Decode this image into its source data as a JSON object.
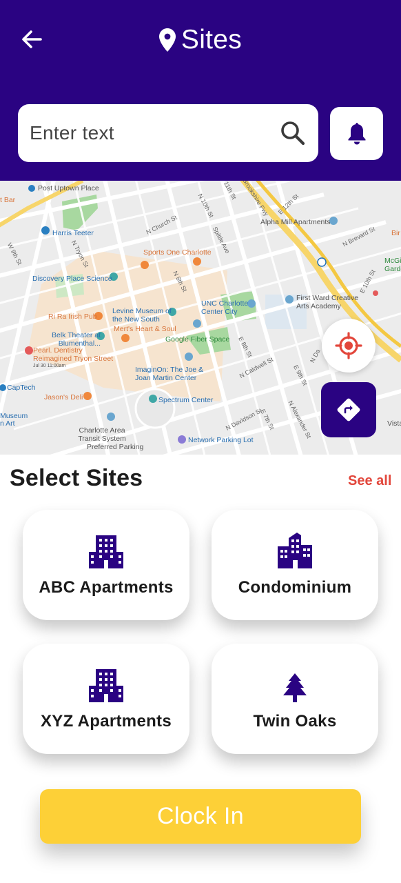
{
  "header": {
    "title": "Sites",
    "colors": {
      "primary": "#2a0382",
      "accent_yellow": "#fdd037",
      "accent_red": "#e2463b"
    },
    "back_icon": "arrow-left-icon",
    "title_icon": "map-pin-icon"
  },
  "search": {
    "placeholder": "Enter text",
    "icon": "search-icon",
    "notification_icon": "bell-icon"
  },
  "map": {
    "places": [
      "Post Uptown Place",
      "Harris Teeter",
      "Sports One Charlotte",
      "Alpha Mill Apartments",
      "Discovery Place Science",
      "UNC Charlotte Center City",
      "First Ward Creative Arts Academy",
      "Levine Museum of the New South",
      "Ri Ra Irish Pub",
      "Mert's Heart & Soul",
      "Belk Theater at Blumenthal...",
      "Google Fiber Space",
      "Pearl. Dentistry Reimagined Tryon Street",
      "Jul 30 11:00am",
      "ImaginOn: The Joe & Joan Martin Center",
      "CapTech",
      "Jason's Deli",
      "Spectrum Center",
      "Museum",
      "n Art",
      "Charlotte Area Transit System",
      "Preferred Parking",
      "Network Parking Lot",
      "Bir",
      "McGi Garden",
      "Vista",
      "t Bar"
    ],
    "streets": [
      "11th St",
      "E 12th St",
      "N Church St",
      "N 10th St",
      "N 8th St",
      "W 9th St",
      "N Caldwell St",
      "N Davidson St",
      "E 7th St",
      "E 8th St",
      "N Alexander St",
      "E 10th St",
      "N Brevard St",
      "E 9th St",
      "Brookshire Fwy",
      "Spittle Ave",
      "N Tryon St",
      "N Da"
    ],
    "locate_icon": "crosshair-location-icon",
    "directions_icon": "directions-arrow-icon"
  },
  "sites": {
    "title": "Select Sites",
    "see_all": "See all",
    "items": [
      {
        "label": "ABC Apartments",
        "icon": "building-icon"
      },
      {
        "label": "Condominium",
        "icon": "city-building-icon"
      },
      {
        "label": "XYZ Apartments",
        "icon": "building-icon"
      },
      {
        "label": "Twin Oaks",
        "icon": "tree-icon"
      }
    ]
  },
  "actions": {
    "clock_in": "Clock In"
  }
}
